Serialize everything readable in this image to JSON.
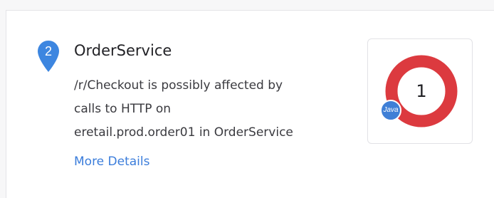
{
  "problem": {
    "index": "2",
    "service_name": "OrderService",
    "description_lines": [
      "/r/Checkout is possibly affected by",
      "calls to HTTP on",
      "eretail.prod.order01 in OrderService"
    ],
    "more_details_label": "More Details"
  },
  "impact": {
    "count": "1",
    "technology_label": "Java",
    "ring_color": "#dc3a3f",
    "tech_color": "#3f7fd6"
  },
  "colors": {
    "pin": "#3d86e0",
    "link": "#3b7ddb"
  }
}
